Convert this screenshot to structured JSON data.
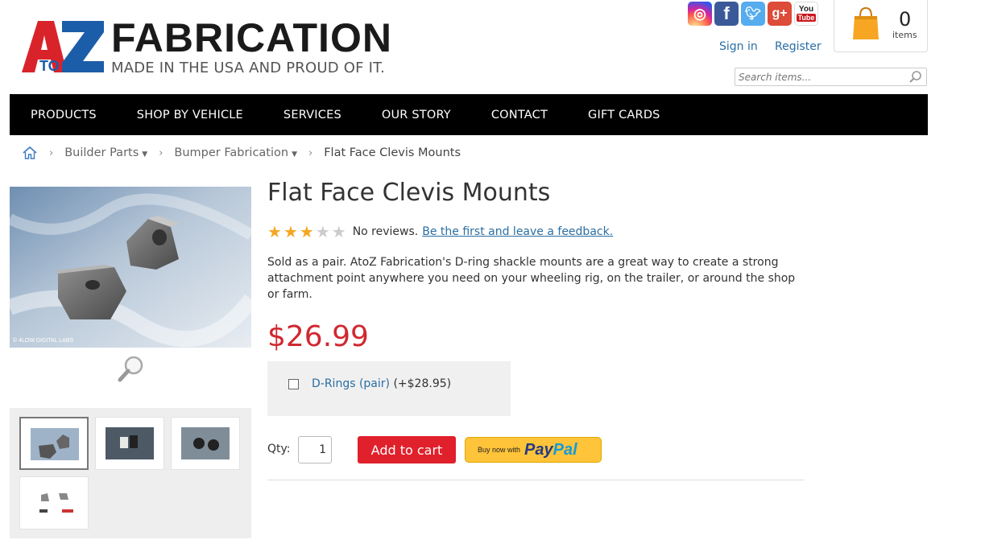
{
  "header": {
    "logo_mark": "AtoZ",
    "logo_title": "FABRICATION",
    "logo_tagline": "MADE IN THE USA AND PROUD OF IT.",
    "social": [
      {
        "name": "instagram",
        "glyph": "◎",
        "color": "#c13584"
      },
      {
        "name": "facebook",
        "glyph": "f",
        "color": "#3b5998"
      },
      {
        "name": "twitter",
        "glyph": "t",
        "color": "#55acee"
      },
      {
        "name": "google-plus",
        "glyph": "g+",
        "color": "#dd4b39"
      },
      {
        "name": "youtube",
        "glyph": "You Tube",
        "color": "#cc181e"
      }
    ],
    "sign_in": "Sign in",
    "register": "Register",
    "cart_count": "0",
    "cart_label": "items",
    "search_placeholder": "Search items..."
  },
  "nav": {
    "items": [
      "PRODUCTS",
      "SHOP BY VEHICLE",
      "SERVICES",
      "OUR STORY",
      "CONTACT",
      "GIFT CARDS"
    ]
  },
  "breadcrumb": {
    "items": [
      "Builder Parts",
      "Bumper Fabrication"
    ],
    "current": "Flat Face Clevis Mounts"
  },
  "gallery": {
    "watermark": "© 4LOW DIGITAL LABS",
    "thumbnail_count": 4,
    "active_thumbnail": 1
  },
  "product": {
    "title": "Flat Face Clevis Mounts",
    "rating": 3,
    "rating_max": 5,
    "reviews_text": "No reviews.",
    "reviews_link": "Be the first and leave a feedback.",
    "description": "Sold as a pair. AtoZ Fabrication's D-ring shackle mounts are a great way to create a strong attachment point anywhere you need on your wheeling rig, on the trailer, or around the shop or farm.",
    "price": "$26.99",
    "option_name": "D-Rings (pair)",
    "option_modifier": "(+$28.95)",
    "option_checked": false,
    "qty_label": "Qty:",
    "qty_value": "1",
    "add_to_cart": "Add to cart",
    "paypal_prefix": "Buy now with",
    "paypal_word_1": "Pay",
    "paypal_word_2": "Pal"
  },
  "colors": {
    "price": "#d0282f",
    "add_to_cart": "#e0202b",
    "link": "#2a6ea3",
    "star_on": "#f5a623",
    "star_off": "#cccccc"
  }
}
